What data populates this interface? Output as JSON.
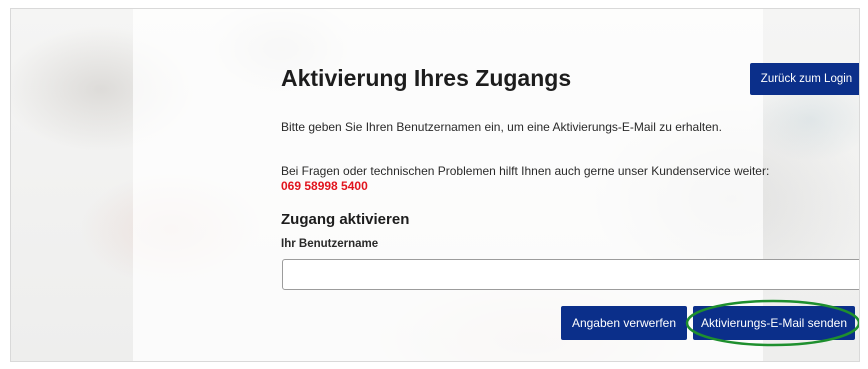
{
  "page": {
    "title": "Aktivierung Ihres Zugangs",
    "back_button": "Zurück zum Login",
    "intro_text": "Bitte geben Sie Ihren Benutzernamen ein, um eine Aktivierungs-E-Mail zu erhalten.",
    "help_text": "Bei Fragen oder technischen Problemen hilft Ihnen auch gerne unser Kundenservice weiter:",
    "phone": "069 58998 5400"
  },
  "form": {
    "section_title": "Zugang aktivieren",
    "username_label": "Ihr Benutzername",
    "username_value": "",
    "discard_button": "Angaben verwerfen",
    "submit_button": "Aktivierungs-E-Mail senden"
  },
  "colors": {
    "primary_button": "#0b2f8a",
    "phone_text": "#e1141e",
    "highlight_ellipse": "#1e8f2e"
  }
}
